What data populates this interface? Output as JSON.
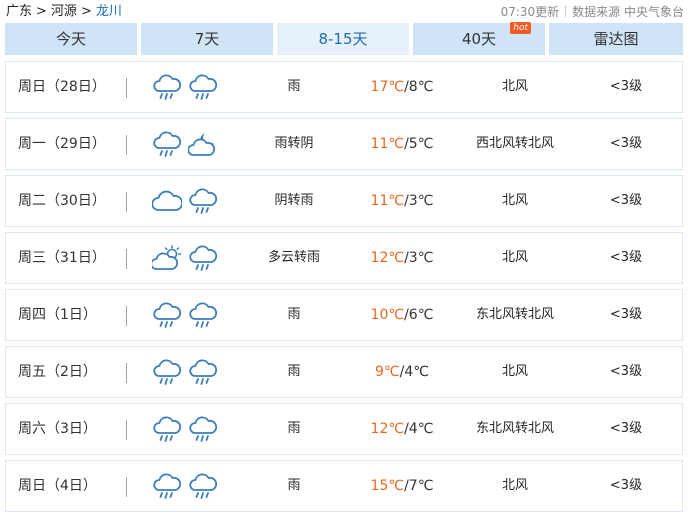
{
  "breadcrumb": {
    "province": "广东",
    "city": "河源",
    "county": "龙川",
    "separator": ">"
  },
  "meta": {
    "updated": "07:30更新",
    "source": "数据来源 中央气象台"
  },
  "tabs": [
    {
      "label": "今天"
    },
    {
      "label": "7天"
    },
    {
      "label": "8-15天"
    },
    {
      "label": "40天",
      "badge": "hot"
    },
    {
      "label": "雷达图"
    }
  ],
  "active_tab": "8-15天",
  "colors": {
    "accent": "#1f6db1",
    "high_temp": "#e8681e",
    "tab_bg": "#cfe5f7",
    "hot_badge": "#f15a22"
  },
  "forecast": [
    {
      "day": "周日（28日）",
      "icons": [
        "rain-icon",
        "rain-icon"
      ],
      "condition": "雨",
      "high": "17℃",
      "low": "/8℃",
      "wind": "北风",
      "level": "<3级"
    },
    {
      "day": "周一（29日）",
      "icons": [
        "rain-icon",
        "cloudy-night-icon"
      ],
      "condition": "雨转阴",
      "high": "11℃",
      "low": "/5℃",
      "wind": "西北风转北风",
      "level": "<3级"
    },
    {
      "day": "周二（30日）",
      "icons": [
        "overcast-icon",
        "rain-icon"
      ],
      "condition": "阴转雨",
      "high": "11℃",
      "low": "/3℃",
      "wind": "北风",
      "level": "<3级"
    },
    {
      "day": "周三（31日）",
      "icons": [
        "partly-cloudy-icon",
        "rain-icon"
      ],
      "condition": "多云转雨",
      "high": "12℃",
      "low": "/3℃",
      "wind": "北风",
      "level": "<3级"
    },
    {
      "day": "周四（1日）",
      "icons": [
        "rain-icon",
        "rain-icon"
      ],
      "condition": "雨",
      "high": "10℃",
      "low": "/6℃",
      "wind": "东北风转北风",
      "level": "<3级"
    },
    {
      "day": "周五（2日）",
      "icons": [
        "rain-icon",
        "rain-icon"
      ],
      "condition": "雨",
      "high": "9℃",
      "low": "/4℃",
      "wind": "北风",
      "level": "<3级"
    },
    {
      "day": "周六（3日）",
      "icons": [
        "rain-icon",
        "rain-icon"
      ],
      "condition": "雨",
      "high": "12℃",
      "low": "/4℃",
      "wind": "东北风转北风",
      "level": "<3级"
    },
    {
      "day": "周日（4日）",
      "icons": [
        "rain-icon",
        "rain-icon"
      ],
      "condition": "雨",
      "high": "15℃",
      "low": "/7℃",
      "wind": "北风",
      "level": "<3级"
    }
  ]
}
